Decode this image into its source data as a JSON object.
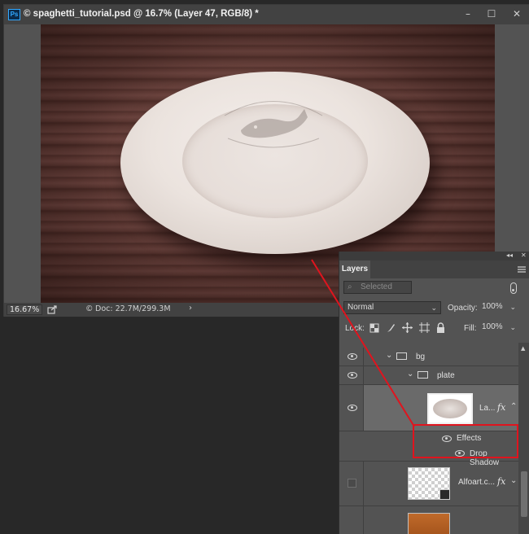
{
  "document": {
    "title": "© spaghetti_tutorial.psd @ 16.7% (Layer 47, RGB/8) *",
    "zoom": "16.67%",
    "doc_info": "Doc: 22.7M/299.3M",
    "window_controls": {
      "minimize": "–",
      "maximize": "☐",
      "close": "✕"
    }
  },
  "panel": {
    "tab_label": "Layers",
    "collapse_label": "◂◂",
    "close_label": "✕",
    "filter_placeholder": "Selected",
    "blend_mode": "Normal",
    "opacity_label": "Opacity:",
    "opacity_value": "100%",
    "lock_label": "Lock:",
    "fill_label": "Fill:",
    "fill_value": "100%"
  },
  "layers": [
    {
      "type": "group",
      "name": "bg",
      "visible": true,
      "expanded": true
    },
    {
      "type": "group",
      "name": "plate",
      "visible": true,
      "expanded": true
    },
    {
      "type": "layer",
      "name": "La...",
      "visible": true,
      "selected": true,
      "has_fx": true
    },
    {
      "type": "effects",
      "name": "Effects",
      "visible": true
    },
    {
      "type": "effect",
      "name": "Drop Shadow",
      "visible": true
    },
    {
      "type": "layer",
      "name": "Alfoart.c...",
      "visible": false,
      "has_fx": true
    },
    {
      "type": "layer",
      "name": "",
      "visible": false
    }
  ],
  "fx_symbol": "fx",
  "colors": {
    "annotation": "#e0141e",
    "panel_bg": "#535353",
    "selected_row": "#6a6a6a"
  }
}
